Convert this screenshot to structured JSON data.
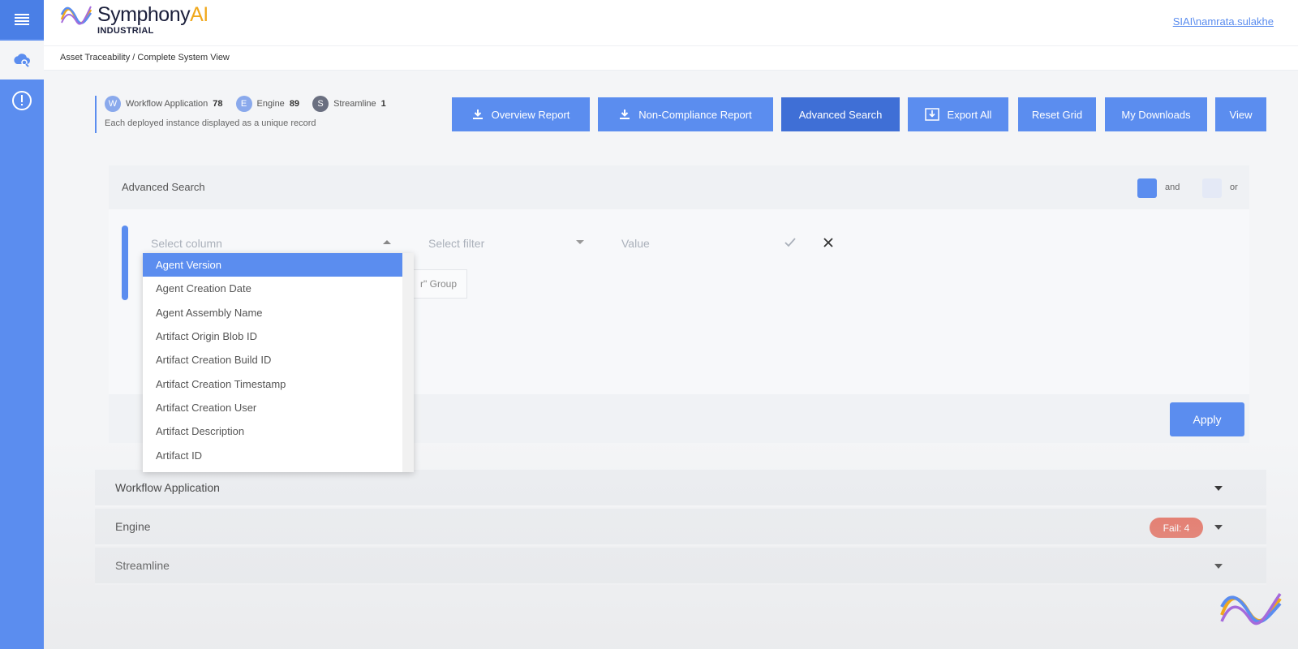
{
  "header": {
    "brand_main": "Symphony",
    "brand_accent": "AI",
    "brand_sub": "INDUSTRIAL",
    "user": "SIAI\\namrata.sulakhe"
  },
  "breadcrumb": "Asset Traceability / Complete System View",
  "summary": {
    "items": [
      {
        "initial": "W",
        "label": "Workflow Application",
        "count": "78",
        "color": "#8aa9ec"
      },
      {
        "initial": "E",
        "label": "Engine",
        "count": "89",
        "color": "#8aa9ec"
      },
      {
        "initial": "S",
        "label": "Streamline",
        "count": "1",
        "color": "#6a6f80"
      }
    ],
    "note": "Each deployed instance displayed as a unique record"
  },
  "toolbar": {
    "overview": "Overview Report",
    "noncompliance": "Non-Compliance Report",
    "advanced": "Advanced Search",
    "export": "Export All",
    "reset": "Reset Grid",
    "downloads": "My Downloads",
    "view": "View"
  },
  "search": {
    "title": "Advanced Search",
    "and_label": "and",
    "or_label": "or",
    "column_placeholder": "Select column",
    "filter_placeholder": "Select filter",
    "value_placeholder": "Value",
    "group_label": "r\" Group",
    "apply": "Apply"
  },
  "dropdown": {
    "items": [
      "Agent Version",
      "Agent Creation Date",
      "Agent Assembly Name",
      "Artifact Origin Blob ID",
      "Artifact Creation Build ID",
      "Artifact Creation Timestamp",
      "Artifact Creation User",
      "Artifact Description",
      "Artifact ID"
    ],
    "selected_index": 0
  },
  "sections": [
    {
      "label": "Workflow Application",
      "badge": ""
    },
    {
      "label": "Engine",
      "badge": "Fail: 4"
    },
    {
      "label": "Streamline",
      "badge": ""
    }
  ],
  "colors": {
    "primary": "#5b8def",
    "primary_active": "#3f6fd6",
    "fail": "#e46a5a"
  },
  "icons": [
    "menu-icon",
    "cloud-search-icon",
    "alert-icon",
    "download-icon",
    "export-icon",
    "check-icon",
    "close-icon",
    "chevron-down-icon",
    "chevron-up-icon"
  ]
}
